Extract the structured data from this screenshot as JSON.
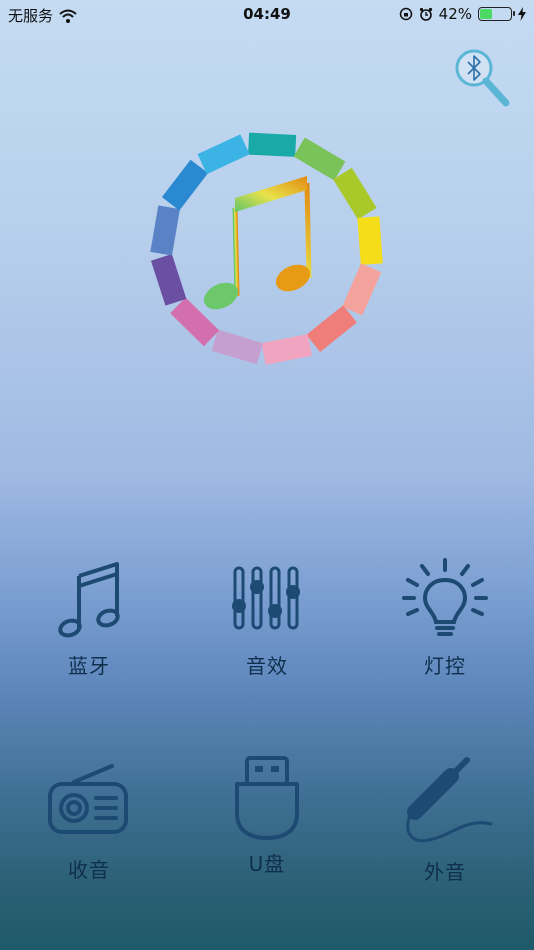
{
  "status_bar": {
    "carrier": "无服务",
    "time": "04:49",
    "battery_percent": "42%",
    "battery_level": 0.42
  },
  "header": {
    "bluetooth_search_icon": "bluetooth-search-icon"
  },
  "logo": {
    "icon": "music-note-color-ring-icon"
  },
  "menu": [
    {
      "label": "蓝牙",
      "icon": "music-note-icon"
    },
    {
      "label": "音效",
      "icon": "equalizer-icon"
    },
    {
      "label": "灯控",
      "icon": "light-bulb-icon"
    },
    {
      "label": "收音",
      "icon": "radio-icon"
    },
    {
      "label": "U盘",
      "icon": "usb-drive-icon"
    },
    {
      "label": "外音",
      "icon": "aux-cable-icon"
    }
  ],
  "colors": {
    "icon_color": "#1c4a73",
    "accent_bt": "#5bb6d6"
  }
}
